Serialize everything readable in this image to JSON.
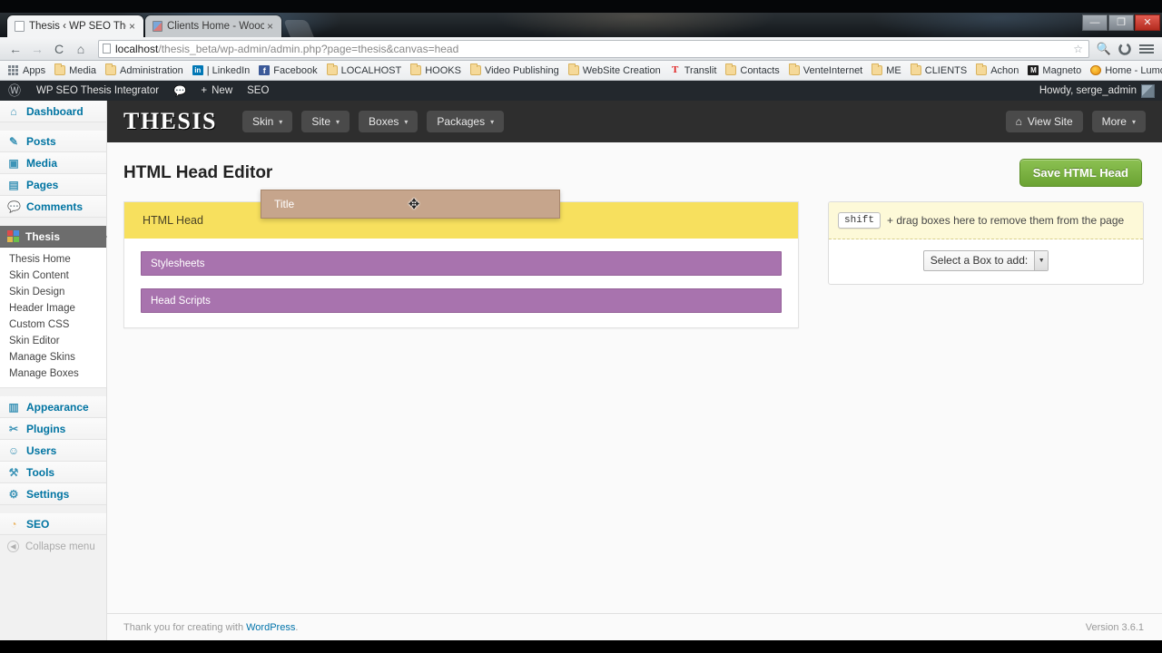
{
  "browser": {
    "tabs": [
      {
        "title": "Thesis ‹ WP SEO Thesis Int",
        "close": "×",
        "active": true
      },
      {
        "title": "Clients Home - Woocom",
        "close": "×",
        "active": false
      }
    ],
    "window_controls": {
      "minimize": "—",
      "maximize": "❐",
      "close": "✕"
    },
    "nav": {
      "back": "←",
      "forward": "→",
      "reload": "C",
      "home": "⌂",
      "star": "☆",
      "search_plugin": "🔍",
      "extension": "●",
      "menu": "menu"
    },
    "omnibox": {
      "url_host": "localhost",
      "url_path": "/thesis_beta/wp-admin/admin.php?page=thesis&canvas=head"
    },
    "bookmarks": [
      {
        "label": "Apps",
        "icon": "apps-grid-icon"
      },
      {
        "label": "Media",
        "icon": "folder-icon"
      },
      {
        "label": "Administration",
        "icon": "folder-icon"
      },
      {
        "label": "| LinkedIn",
        "icon": "linkedin-icon"
      },
      {
        "label": "Facebook",
        "icon": "facebook-icon"
      },
      {
        "label": "LOCALHOST",
        "icon": "folder-icon"
      },
      {
        "label": "HOOKS",
        "icon": "folder-icon"
      },
      {
        "label": "Video Publishing",
        "icon": "folder-icon"
      },
      {
        "label": "WebSite Creation",
        "icon": "folder-icon"
      },
      {
        "label": "Translit",
        "icon": "translit-icon"
      },
      {
        "label": "Contacts",
        "icon": "folder-icon"
      },
      {
        "label": "VenteInternet",
        "icon": "folder-icon"
      },
      {
        "label": "ME",
        "icon": "folder-icon"
      },
      {
        "label": "CLIENTS",
        "icon": "folder-icon"
      },
      {
        "label": "Achon",
        "icon": "folder-icon"
      },
      {
        "label": "Magneto",
        "icon": "magento-icon"
      },
      {
        "label": "Home - Lumosity",
        "icon": "lumosity-icon"
      }
    ]
  },
  "adminbar": {
    "logo": "Ⓦ",
    "site_name": "WP SEO Thesis Integrator",
    "comments_icon": "💬",
    "new_label": "New",
    "new_plus": "+",
    "seo_label": "SEO",
    "howdy": "Howdy, serge_admin"
  },
  "adminmenu": {
    "items": [
      {
        "label": "Dashboard",
        "icon": "⌂",
        "current": false
      },
      {
        "label": "Posts",
        "icon": "✎",
        "current": false
      },
      {
        "label": "Media",
        "icon": "▣",
        "current": false
      },
      {
        "label": "Pages",
        "icon": "▤",
        "current": false
      },
      {
        "label": "Comments",
        "icon": "💬",
        "current": false
      },
      {
        "label": "Thesis",
        "icon": "colorblocks",
        "current": true
      }
    ],
    "thesis_submenu": [
      "Thesis Home",
      "Skin Content",
      "Skin Design",
      "Header Image",
      "Custom CSS",
      "Skin Editor",
      "Manage Skins",
      "Manage Boxes"
    ],
    "items2": [
      {
        "label": "Appearance",
        "icon": "▥"
      },
      {
        "label": "Plugins",
        "icon": "✂"
      },
      {
        "label": "Users",
        "icon": "☺"
      },
      {
        "label": "Tools",
        "icon": "⚒"
      },
      {
        "label": "Settings",
        "icon": "⚙"
      }
    ],
    "items3": [
      {
        "label": "SEO",
        "icon": "◔"
      }
    ],
    "collapse": {
      "label": "Collapse menu",
      "arrow": "◀"
    }
  },
  "thesis": {
    "logo": "THESIS",
    "nav": [
      {
        "label": "Skin",
        "caret": "▾"
      },
      {
        "label": "Site",
        "caret": "▾"
      },
      {
        "label": "Boxes",
        "caret": "▾"
      },
      {
        "label": "Packages",
        "caret": "▾"
      }
    ],
    "view_site": {
      "label": "View Site",
      "icon": "⌂"
    },
    "more": {
      "label": "More",
      "caret": "▾"
    },
    "page_title": "HTML Head Editor",
    "save_button": "Save HTML Head",
    "canvas": {
      "head_box_label": "HTML Head",
      "dragging_box_label": "Title",
      "drag_cursor": "✥",
      "children": [
        {
          "label": "Stylesheets"
        },
        {
          "label": "Head Scripts"
        }
      ]
    },
    "panel": {
      "shift_key": "shift",
      "trash_text": "+ drag boxes here to remove them from the page",
      "select_label": "Select a Box to add:",
      "select_caret": "▼"
    }
  },
  "footer": {
    "thanks_prefix": "Thank you for creating with ",
    "thanks_link": "WordPress",
    "thanks_suffix": ".",
    "version": "Version 3.6.1"
  },
  "colors": {
    "thesis_header": "#2e2e2e",
    "head_box_yellow": "#f7e05e",
    "child_box_purple": "#a873ae",
    "dragging_box_tan": "#c6a58c",
    "save_green": "#6aa232",
    "admin_dark": "#23282d",
    "link_blue": "#0073aa"
  }
}
